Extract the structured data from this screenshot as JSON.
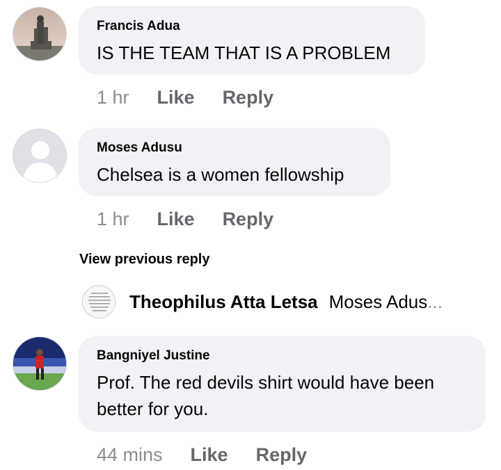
{
  "comments": [
    {
      "author": "Francis Adua",
      "text": "IS THE TEAM THAT IS A PROBLEM",
      "time": "1 hr",
      "like": "Like",
      "reply": "Reply"
    },
    {
      "author": "Moses Adusu",
      "text": "Chelsea is a women fellowship",
      "time": "1 hr",
      "like": "Like",
      "reply": "Reply"
    },
    {
      "author": "Bangniyel Justine",
      "text_line1": "Prof. The red devils shirt would have been",
      "text_line2": "better for you.",
      "time": "44 mins",
      "like": "Like",
      "reply": "Reply"
    }
  ],
  "view_previous_reply": "View previous reply",
  "reply_preview": {
    "author": "Theophilus Atta Letsa",
    "snippet": "Moses Adus",
    "ellipsis": "..."
  },
  "icons": [
    "avatar-photo-monument",
    "avatar-default-silhouette",
    "avatar-text-image",
    "avatar-photo-footballer"
  ],
  "colors": {
    "bubble": "#f0f2f5",
    "meta": "#65676b",
    "time": "#8a8d91"
  }
}
